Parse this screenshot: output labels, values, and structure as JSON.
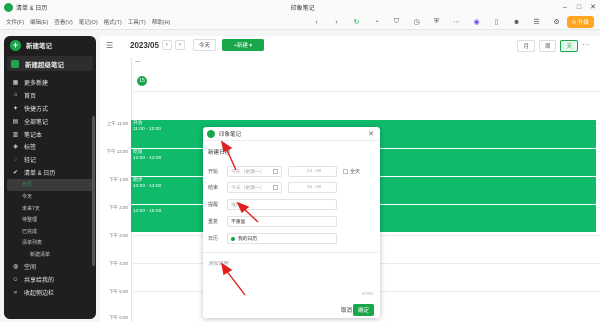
{
  "window": {
    "app_name": "清单 & 日历",
    "title": "印象笔记"
  },
  "menu": [
    "文件(F)",
    "编辑(E)",
    "查看(V)",
    "笔记(O)",
    "格式(T)",
    "工具(T)",
    "帮助(H)"
  ],
  "toolbar_icons": [
    "back-icon",
    "forward-icon",
    "sync-icon",
    "bell-icon",
    "shield-icon",
    "clock-icon",
    "security-icon",
    "more-icon",
    "ai-icon",
    "phone-icon",
    "avatar-icon",
    "menu-icon"
  ],
  "upgrade_label": "升级",
  "sidebar": {
    "new_note": "新建笔记",
    "new_super_note": "新建超级笔记",
    "items": [
      {
        "icon": "grid-icon",
        "label": "更多新建"
      },
      {
        "icon": "home-icon",
        "label": "首页"
      },
      {
        "icon": "shortcut-icon",
        "label": "快捷方式"
      },
      {
        "icon": "note-icon",
        "label": "全部笔记"
      },
      {
        "icon": "notebook-icon",
        "label": "笔记本"
      },
      {
        "icon": "tag-icon",
        "label": "标签"
      },
      {
        "icon": "outline-icon",
        "label": "轻记"
      },
      {
        "icon": "check-icon",
        "label": "清单 & 日历"
      }
    ],
    "sub_items": [
      "日历",
      "今天",
      "未来7天",
      "待整理",
      "已完成",
      "清单列表",
      "新建清单"
    ],
    "bottom_items": [
      {
        "icon": "space-icon",
        "label": "空间"
      },
      {
        "icon": "share-icon",
        "label": "共享给我的"
      },
      {
        "icon": "collapse-icon",
        "label": "收起侧边栏"
      }
    ]
  },
  "calendar": {
    "date": "2023/05",
    "today_label": "今天",
    "new_label": "+新建",
    "views": [
      "月",
      "周",
      "天"
    ],
    "day_header": "一",
    "day_number": "15",
    "hours": [
      "上午 11:00",
      "下午 12:00",
      "下午 1:00",
      "下午 2:00",
      "下午 3:00",
      "下午 4:00",
      "下午 5:00",
      "下午 6:00"
    ],
    "events": [
      {
        "title": "开会",
        "time": "11:00 - 12:00"
      },
      {
        "title": "吃饭",
        "time": "12:00 - 13:00"
      },
      {
        "title": "跑步",
        "time": "13:00 - 14:00"
      },
      {
        "title": "",
        "time": "14:00 - 15:00"
      }
    ]
  },
  "dialog": {
    "title": "印象笔记",
    "field_title": "新建日程",
    "start_label": "开始",
    "start_date": "今天（星期一）",
    "start_time": "14 : 00",
    "allday_label": "全天",
    "end_label": "结束",
    "end_date": "今天（星期一）",
    "end_time": "15 : 00",
    "remind_label": "提醒",
    "remind_value": "准时",
    "repeat_label": "重复",
    "repeat_value": "不重复",
    "calendar_label": "日历",
    "calendar_value": "我的日历",
    "desc_placeholder": "添加说明",
    "char_count": "0/200",
    "cancel": "取消",
    "confirm": "确定"
  }
}
